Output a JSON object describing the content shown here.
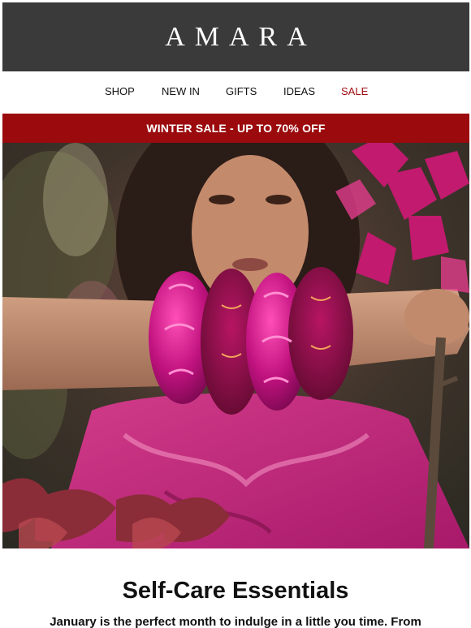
{
  "header": {
    "brand": "AMARA"
  },
  "nav": {
    "items": [
      {
        "label": "SHOP",
        "color": "#111111"
      },
      {
        "label": "NEW IN",
        "color": "#111111"
      },
      {
        "label": "GIFTS",
        "color": "#111111"
      },
      {
        "label": "IDEAS",
        "color": "#111111"
      },
      {
        "label": "SALE",
        "color": "#a10d12"
      }
    ]
  },
  "banner": {
    "text": "WINTER SALE - UP TO 70% OFF",
    "background": "#9b0a0d"
  },
  "hero": {
    "image": "woman-with-pink-silk-scrunchies-photo"
  },
  "content": {
    "title": "Self-Care Essentials",
    "body": "January is the perfect month to indulge in a little you time. From"
  },
  "colors": {
    "header_bg": "#3a3a3a",
    "accent": "#9b0a0d"
  }
}
